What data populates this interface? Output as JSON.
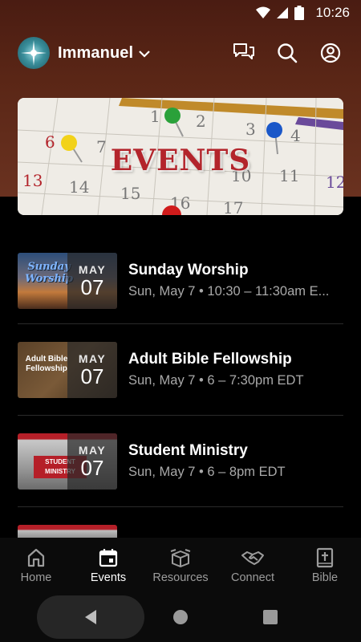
{
  "status_bar": {
    "time": "10:26"
  },
  "header": {
    "church_name": "Immanuel"
  },
  "banner": {
    "title": "EVENTS"
  },
  "events": [
    {
      "thumb_caption": "Sunday Worship",
      "month": "MAY",
      "day": "07",
      "title": "Sunday Worship",
      "time": "Sun, May 7 • 10:30 – 11:30am E..."
    },
    {
      "thumb_caption": "Adult Bible Fellowship",
      "month": "MAY",
      "day": "07",
      "title": "Adult Bible Fellowship",
      "time": "Sun, May 7 • 6 – 7:30pm EDT"
    },
    {
      "thumb_caption": "STUDENT MINISTRY",
      "month": "MAY",
      "day": "07",
      "title": "Student Ministry",
      "time": "Sun, May 7 • 6 – 8pm EDT"
    }
  ],
  "bottom_nav": [
    {
      "label": "Home",
      "icon": "home-icon"
    },
    {
      "label": "Events",
      "icon": "calendar-icon",
      "active": true
    },
    {
      "label": "Resources",
      "icon": "box-icon"
    },
    {
      "label": "Connect",
      "icon": "handshake-icon"
    },
    {
      "label": "Bible",
      "icon": "bible-icon"
    }
  ],
  "colors": {
    "header_bg": "#5a2616",
    "banner_title": "#b3242b",
    "active_nav": "#ffffff",
    "inactive_nav": "#9c9c9c"
  }
}
